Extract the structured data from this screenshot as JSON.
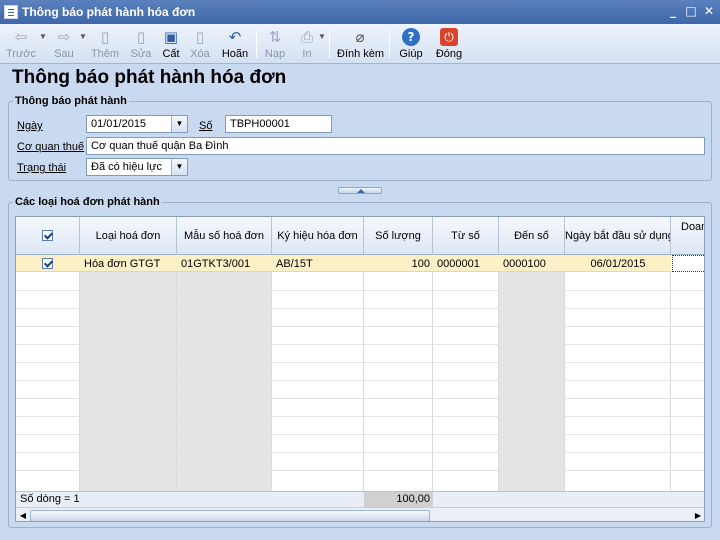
{
  "window": {
    "title": "Thông báo phát hành hóa đơn",
    "controls": [
      "_",
      "□",
      "✕"
    ]
  },
  "toolbar": {
    "buttons": [
      {
        "label": "Trước",
        "icon": "arrow-left-icon",
        "glyph": "⇦",
        "enabled": false
      },
      {
        "label": "Sau",
        "icon": "arrow-right-icon",
        "glyph": "⇨",
        "enabled": false
      },
      {
        "label": "Thêm",
        "icon": "add-document-icon",
        "glyph": "▯",
        "enabled": false
      },
      {
        "label": "Sửa",
        "icon": "edit-document-icon",
        "glyph": "▯",
        "enabled": false
      },
      {
        "label": "Cất",
        "icon": "save-icon",
        "glyph": "▣",
        "enabled": true
      },
      {
        "label": "Xóa",
        "icon": "delete-document-icon",
        "glyph": "▯",
        "enabled": false
      },
      {
        "label": "Hoãn",
        "icon": "undo-icon",
        "glyph": "↶",
        "enabled": true
      },
      {
        "label": "Nạp",
        "icon": "reload-icon",
        "glyph": "⇅",
        "enabled": false
      },
      {
        "label": "In",
        "icon": "print-icon",
        "glyph": "⎙",
        "enabled": false
      },
      {
        "label": "Đính kèm",
        "icon": "attachment-icon",
        "glyph": "⌀",
        "enabled": true
      },
      {
        "label": "Giúp",
        "icon": "help-icon",
        "glyph": "?",
        "enabled": true
      },
      {
        "label": "Đóng",
        "icon": "close-icon",
        "glyph": "⏻",
        "enabled": true
      }
    ]
  },
  "page": {
    "heading": "Thông báo phát hành hóa đơn"
  },
  "form": {
    "group_title": "Thông báo phát hành",
    "date_label": "Ngày",
    "date_value": "01/01/2015",
    "number_label": "Số",
    "number_value": "TBPH00001",
    "tax_office_label": "Cơ quan thuế",
    "tax_office_value": "Cơ quan thuế quận Ba Đình",
    "status_label": "Trạng thái",
    "status_value": "Đã có hiệu lực"
  },
  "grid": {
    "group_title": "Các loại hoá đơn phát hành",
    "columns": [
      "Loại hoá đơn",
      "Mẫu số hoá đơn",
      "Ký hiệu hóa đơn",
      "Số lượng",
      "Từ số",
      "Đến số",
      "Ngày bắt đầu sử dụng",
      "Doan"
    ],
    "rows": [
      {
        "checked": true,
        "type": "Hóa đơn GTGT",
        "template": "01GTKT3/001",
        "symbol": "AB/15T",
        "quantity": "100",
        "from": "0000001",
        "to": "0000100",
        "start_date": "06/01/2015"
      }
    ],
    "footer": {
      "row_count": "Số dòng = 1",
      "total_quantity": "100,00"
    }
  },
  "colors": {
    "background": "#c9d9ef",
    "titlebar": "#3e67a8",
    "selected_row": "#fdf0c7"
  }
}
